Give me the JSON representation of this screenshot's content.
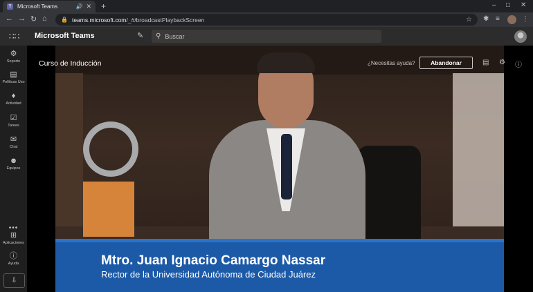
{
  "browser": {
    "tab_title": "Microsoft Teams",
    "url_domain": "teams.microsoft.com",
    "url_path": "/_#/broadcastPlaybackScreen",
    "icons": [
      "back-icon",
      "forward-icon",
      "reload-icon",
      "home-icon",
      "lock-icon",
      "star-icon",
      "extensions-icon",
      "queue-icon",
      "menu-icon"
    ]
  },
  "teams": {
    "app_title": "Microsoft Teams",
    "search_placeholder": "Buscar"
  },
  "rail": {
    "items": [
      {
        "label": "Soporte",
        "icon": "support-icon"
      },
      {
        "label": "Políticas Uso",
        "icon": "policy-icon"
      },
      {
        "label": "Actividad",
        "icon": "bell-icon"
      },
      {
        "label": "Tareas",
        "icon": "tasks-icon"
      },
      {
        "label": "Chat",
        "icon": "chat-icon"
      },
      {
        "label": "Equipos",
        "icon": "teams-icon"
      },
      {
        "label": "Aplicaciones",
        "icon": "apps-icon"
      },
      {
        "label": "Ayuda",
        "icon": "help-icon"
      }
    ],
    "more": "•••"
  },
  "stage": {
    "event_title": "Curso de Inducción",
    "help_link": "¿Necesitas ayuda?",
    "leave_button": "Abandonar",
    "lower_third": {
      "name": "Mtro. Juan Ignacio Camargo Nassar",
      "role": "Rector de la Universidad Autónoma de Ciudad Juárez"
    }
  },
  "colors": {
    "lower_third": "#1c5aa8",
    "teams_purple": "#6264a7"
  }
}
